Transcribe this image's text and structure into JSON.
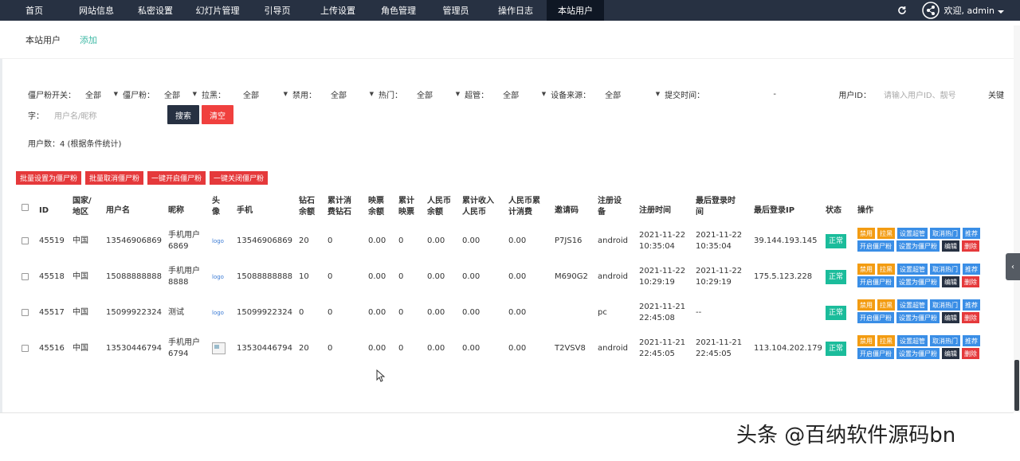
{
  "topnav": {
    "items": [
      "首页",
      "网站信息",
      "私密设置",
      "幻灯片管理",
      "引导页",
      "上传设置",
      "角色管理",
      "管理员",
      "操作日志",
      "本站用户"
    ],
    "active_index": 9,
    "welcome": "欢迎, admin"
  },
  "subtabs": {
    "current": "本站用户",
    "add": "添加"
  },
  "filters": {
    "labels": [
      "僵尸粉开关：",
      "僵尸粉：",
      "拉黑：",
      "禁用：",
      "热门：",
      "超管：",
      "设备来源：",
      "提交时间："
    ],
    "value": "全部",
    "date_separator": "-",
    "userid_label": "用户ID：",
    "userid_placeholder": "请输入用户ID、靓号",
    "keyword_label_a": "关键",
    "keyword_label_b": "字：",
    "keyword_placeholder": "用户名/昵称",
    "search": "搜索",
    "clear": "清空"
  },
  "count_text": "用户数：4 (根据条件统计)",
  "batch_buttons": [
    "批量设置为僵尸粉",
    "批量取消僵尸粉",
    "一键开启僵尸粉",
    "一键关闭僵尸粉"
  ],
  "table": {
    "headers": {
      "id": "ID",
      "country": [
        "国家/",
        "地区"
      ],
      "username": "用户名",
      "nickname": "昵称",
      "avatar": [
        "头",
        "像"
      ],
      "phone": "手机",
      "diamond": [
        "钻石",
        "余额"
      ],
      "diamond_spent": [
        "累计消",
        "费钻石"
      ],
      "ticket": [
        "映票",
        "余额"
      ],
      "ticket_total": [
        "累计",
        "映票"
      ],
      "rmb": [
        "人民币",
        "余额"
      ],
      "rmb_income": [
        "累计收入",
        "人民币"
      ],
      "rmb_spent": [
        "人民币累",
        "计消费"
      ],
      "invite": "邀请码",
      "device": [
        "注册设",
        "备"
      ],
      "reg_time": "注册时间",
      "last_login": [
        "最后登录时",
        "间"
      ],
      "last_ip": "最后登录IP",
      "status": "状态",
      "ops": "操作"
    },
    "rows": [
      {
        "id": "45519",
        "country": "中国",
        "username": "13546906869",
        "nickname": [
          "手机用户",
          "6869"
        ],
        "avatar": "logo",
        "phone": "13546906869",
        "diamond": "20",
        "diamond_spent": "0",
        "ticket": "0.00",
        "ticket_total": "0",
        "rmb": "0.00",
        "rmb_income": "0.00",
        "rmb_spent": "0.00",
        "invite": "P7JS16",
        "device": "android",
        "reg_time": [
          "2021-11-22",
          "10:35:04"
        ],
        "last_login": [
          "2021-11-22",
          "10:35:04"
        ],
        "last_ip": "39.144.193.145",
        "status": "正常"
      },
      {
        "id": "45518",
        "country": "中国",
        "username": "15088888888",
        "nickname": [
          "手机用户",
          "8888"
        ],
        "avatar": "logo",
        "phone": "15088888888",
        "diamond": "10",
        "diamond_spent": "0",
        "ticket": "0.00",
        "ticket_total": "0",
        "rmb": "0.00",
        "rmb_income": "0.00",
        "rmb_spent": "0.00",
        "invite": "M690G2",
        "device": "android",
        "reg_time": [
          "2021-11-22",
          "10:29:19"
        ],
        "last_login": [
          "2021-11-22",
          "10:29:19"
        ],
        "last_ip": "175.5.123.228",
        "status": "正常"
      },
      {
        "id": "45517",
        "country": "中国",
        "username": "15099922324",
        "nickname": [
          "测试",
          ""
        ],
        "avatar": "logo",
        "phone": "15099922324",
        "diamond": "0",
        "diamond_spent": "0",
        "ticket": "0.00",
        "ticket_total": "0",
        "rmb": "0.00",
        "rmb_income": "0.00",
        "rmb_spent": "0.00",
        "invite": "",
        "device": "pc",
        "reg_time": [
          "2021-11-21",
          "22:45:08"
        ],
        "last_login": [
          "--",
          ""
        ],
        "last_ip": "",
        "status": "正常"
      },
      {
        "id": "45516",
        "country": "中国",
        "username": "13530446794",
        "nickname": [
          "手机用户",
          "6794"
        ],
        "avatar": "",
        "phone": "13530446794",
        "diamond": "20",
        "diamond_spent": "0",
        "ticket": "0.00",
        "ticket_total": "0",
        "rmb": "0.00",
        "rmb_income": "0.00",
        "rmb_spent": "0.00",
        "invite": "T2VSV8",
        "device": "android",
        "reg_time": [
          "2021-11-21",
          "22:45:05"
        ],
        "last_login": [
          "2021-11-21",
          "22:45:05"
        ],
        "last_ip": "113.104.202.179",
        "status": "正常"
      }
    ],
    "ops_line1": [
      "禁用",
      "拉黑",
      "设置超管",
      "取消热门",
      "推荐"
    ],
    "ops_line2": [
      "开启僵尸粉",
      "设置为僵尸粉",
      "编辑",
      "删除"
    ]
  },
  "watermark": "头条 @百纳软件源码bn",
  "colors": {
    "nav_bg": "#273142",
    "accent_green": "#1bbc9b",
    "danger": "#e5393b",
    "warning": "#f39c12",
    "info": "#3a8ee6"
  }
}
